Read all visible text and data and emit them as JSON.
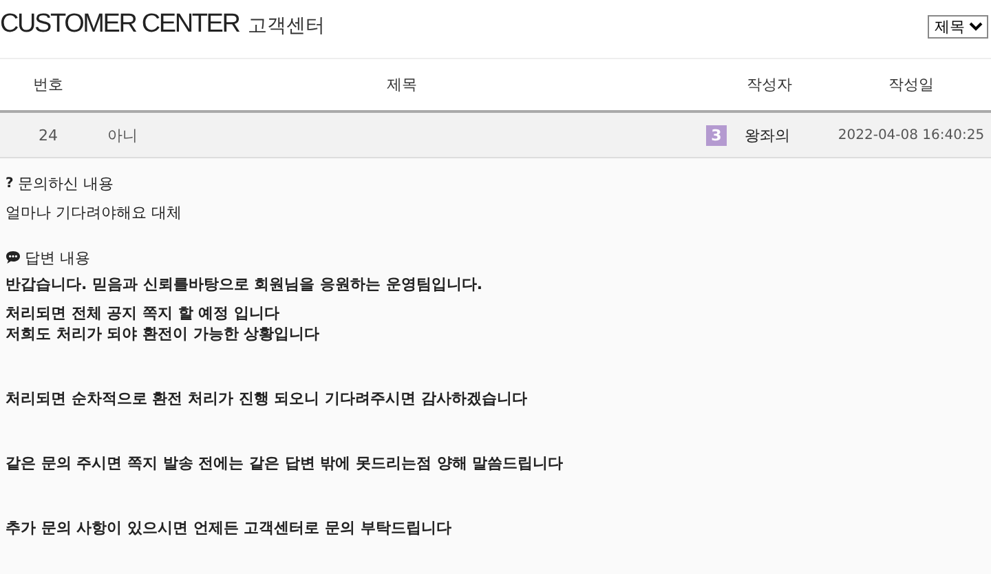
{
  "header": {
    "title": "CUSTOMER CENTER",
    "subtitle": "고객센터",
    "search_select": "제목"
  },
  "table": {
    "columns": [
      "번호",
      "제목",
      "작성자",
      "작성일"
    ],
    "rows": [
      {
        "number": "24",
        "title": "아니",
        "level_badge": "3",
        "author": "왕좌의",
        "date": "2022-04-08 16:40:25"
      }
    ]
  },
  "question": {
    "icon": "?",
    "heading": "문의하신 내용",
    "text": "얼마나 기다려야해요 대체"
  },
  "answer": {
    "heading": "답변 내용",
    "paragraphs": [
      [
        "반갑습니다. 믿음과 신뢰를바탕으로 회원님을 응원하는 운영팀입니다."
      ],
      [
        "처리되면 전체 공지 쪽지 할 예정 입니다",
        "저희도 처리가 되야 환전이 가능한 상황입니다"
      ],
      [
        " 처리되면 순차적으로 환전 처리가 진행 되오니 기다려주시면 감사하겠습니다"
      ],
      [
        "같은 문의 주시면 쪽지 발송 전에는 같은 답변 밖에 못드리는점 양해 말씀드립니다"
      ],
      [
        "추가 문의 사항이 있으시면 언제든 고객센터로 문의 부탁드립니다"
      ]
    ]
  }
}
